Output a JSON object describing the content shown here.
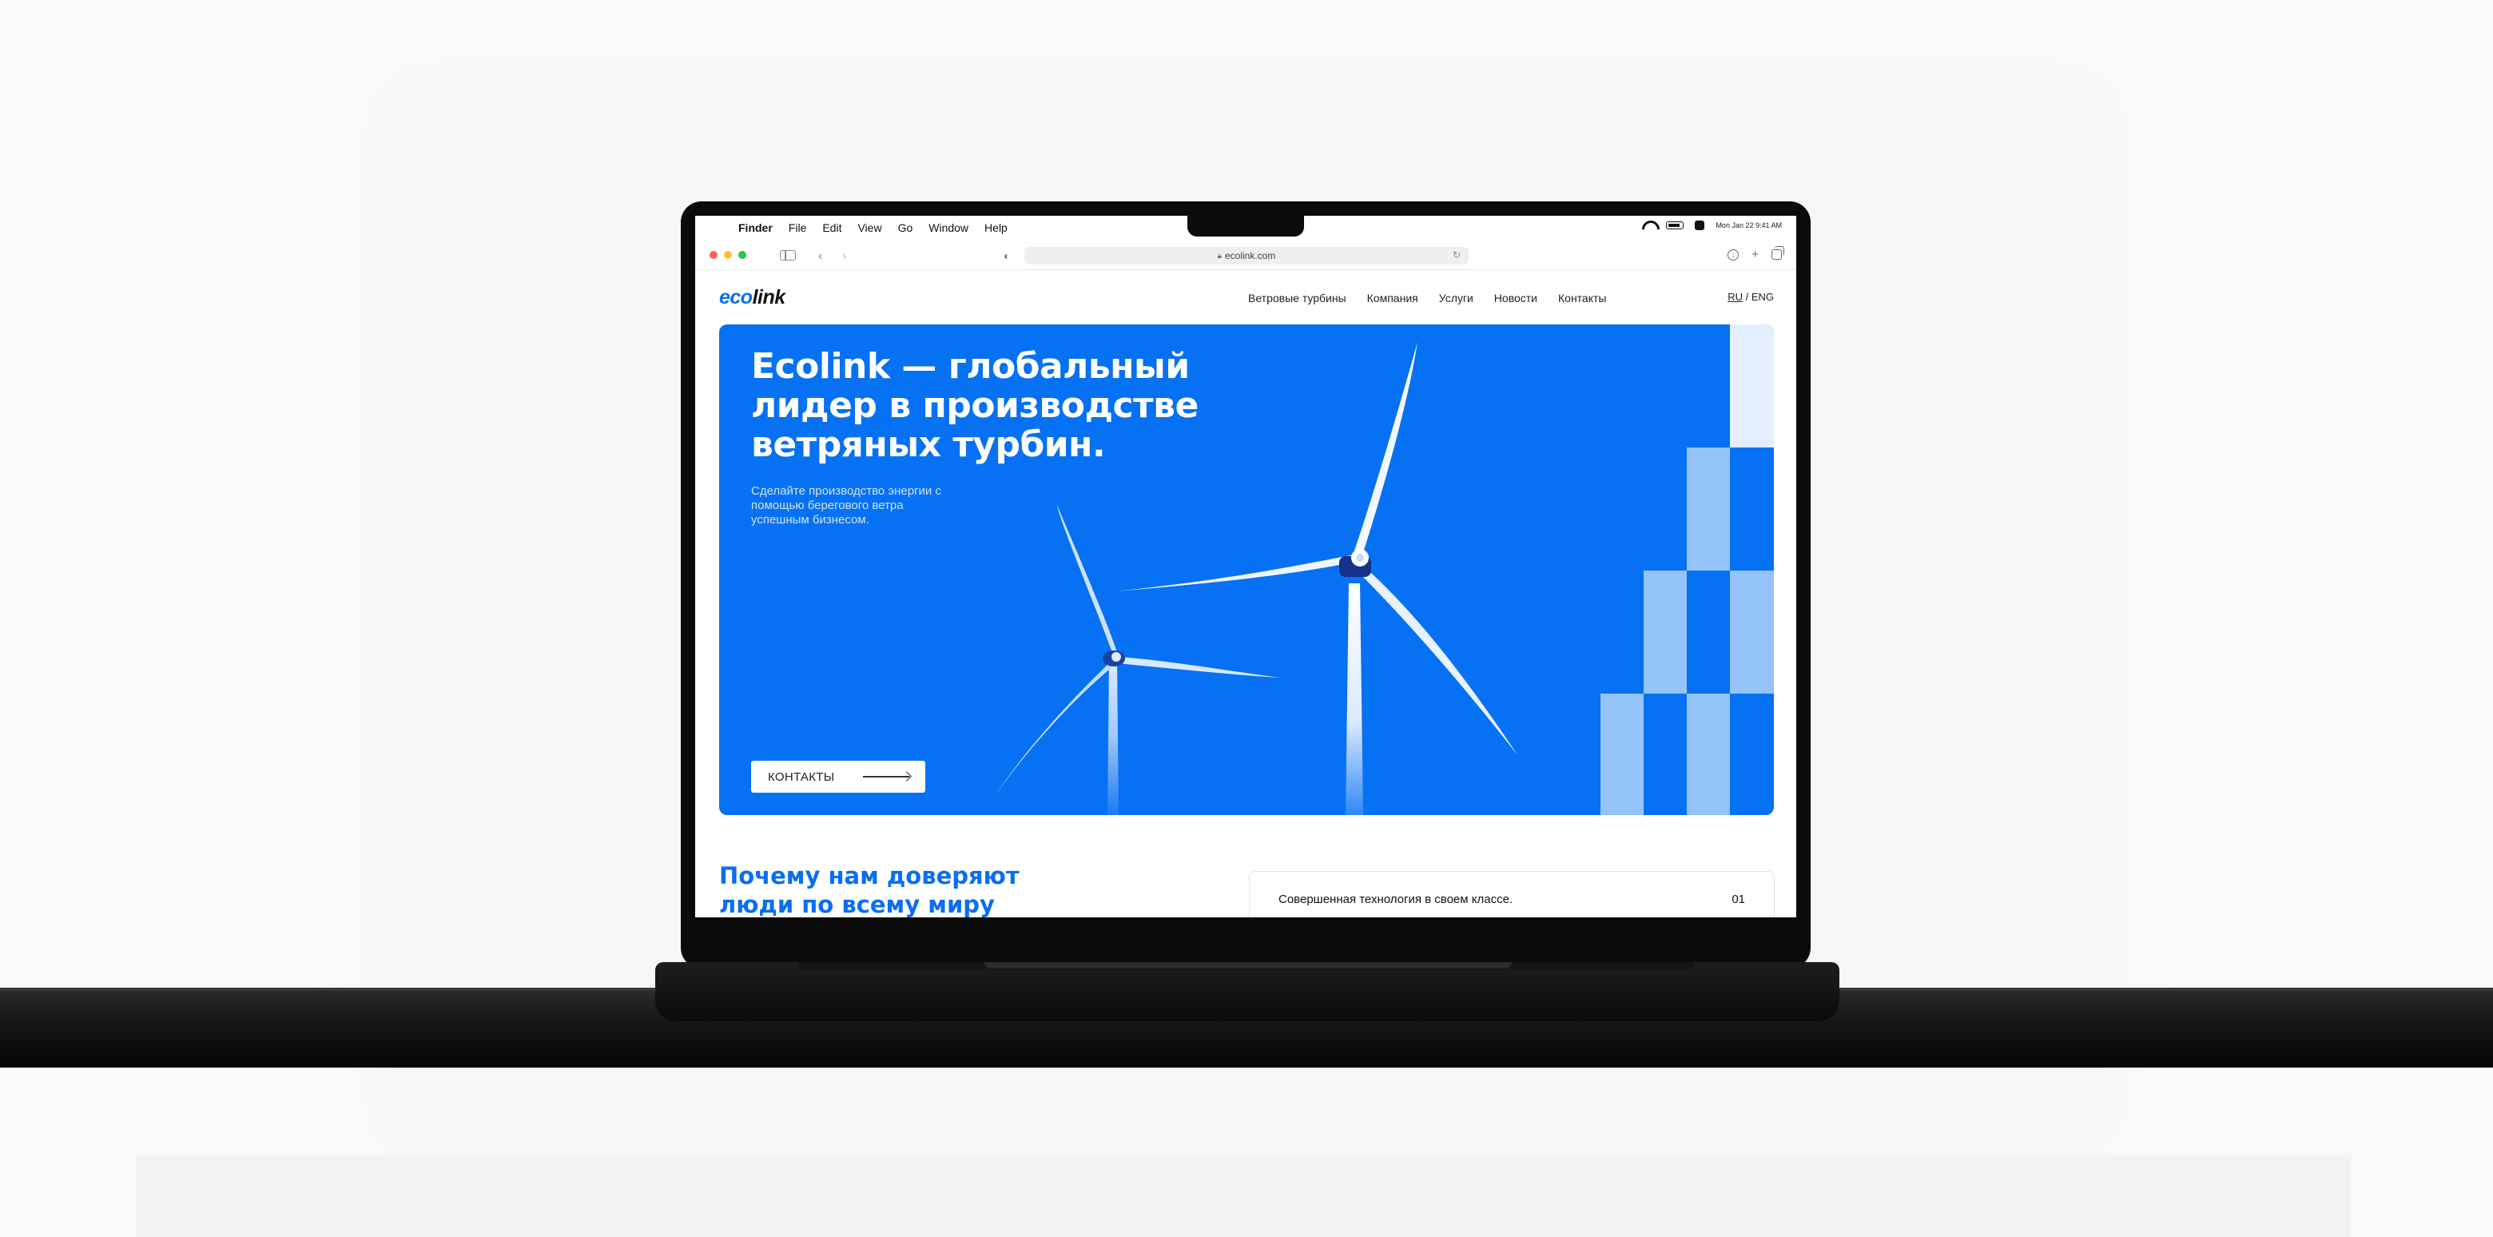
{
  "macos": {
    "menu": [
      "Finder",
      "File",
      "Edit",
      "View",
      "Go",
      "Window",
      "Help"
    ],
    "status_date": "Mon Jan 22  9:41 AM"
  },
  "browser": {
    "url": "ecolink.com"
  },
  "site": {
    "logo_eco": "eco",
    "logo_link": "link",
    "nav": [
      "Ветровые турбины",
      "Компания",
      "Услуги",
      "Новости",
      "Контакты"
    ],
    "lang_ru": "RU",
    "lang_sep": " / ",
    "lang_eng": "ENG",
    "brand_color": "#0671f3"
  },
  "hero": {
    "title": "Ecolink — глобальный лидер в производстве ветряных турбин.",
    "subtitle": "Сделайте производство энергии с помощью берегового ветра успешным бизнесом.",
    "cta_label": "КОНТАКТЫ"
  },
  "why": {
    "title": "Почему нам доверяют люди по всему миру",
    "features": [
      {
        "text": "Совершенная технология в своем классе.",
        "num": "01"
      }
    ]
  }
}
